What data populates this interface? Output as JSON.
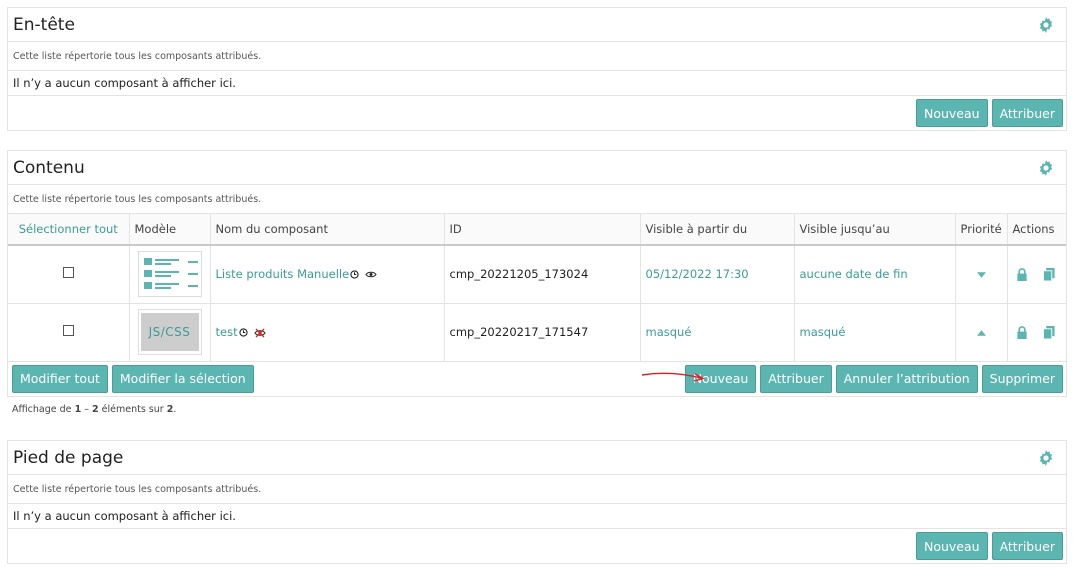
{
  "header_section": {
    "title": "En-tête",
    "description": "Cette liste répertorie tous les composants attribués.",
    "empty_text": "Il n’y a aucun composant à afficher ici.",
    "new_label": "Nouveau",
    "assign_label": "Attribuer"
  },
  "content_section": {
    "title": "Contenu",
    "description": "Cette liste répertorie tous les composants attribués.",
    "columns": {
      "select_all": "Sélectionner tout",
      "model": "Modèle",
      "name": "Nom du composant",
      "id": "ID",
      "visible_from": "Visible à partir du",
      "visible_until": "Visible jusqu’au",
      "priority": "Priorité",
      "actions": "Actions"
    },
    "rows": [
      {
        "name": "Liste produits Manuelle",
        "id": "cmp_20221205_173024",
        "visible_from": "05/12/2022 17:30",
        "visible_until": "aucune date de fin",
        "model_icon": "list-template-icon",
        "visibility_icon": "eye-icon",
        "priority_icon": "arrow-down-icon"
      },
      {
        "name": "test",
        "id": "cmp_20220217_171547",
        "visible_from": "masqué",
        "visible_until": "masqué",
        "model_label": "JS/CSS",
        "visibility_icon": "eye-crossed-icon",
        "priority_icon": "arrow-up-icon"
      }
    ],
    "edit_all_label": "Modifier tout",
    "edit_selection_label": "Modifier la sélection",
    "new_label": "Nouveau",
    "assign_label": "Attribuer",
    "unassign_label": "Annuler l’attribution",
    "delete_label": "Supprimer",
    "pager": {
      "prefix": "Affichage de",
      "from": "1",
      "dash": "–",
      "to": "2",
      "middle": "éléments sur",
      "total": "2",
      "suffix": "."
    }
  },
  "footer_section": {
    "title": "Pied de page",
    "description": "Cette liste répertorie tous les composants attribués.",
    "empty_text": "Il n’y a aucun composant à afficher ici.",
    "new_label": "Nouveau",
    "assign_label": "Attribuer"
  },
  "colors": {
    "accent": "#5bb5b0",
    "link": "#3a9d98",
    "annotation_arrow": "#e02020"
  }
}
